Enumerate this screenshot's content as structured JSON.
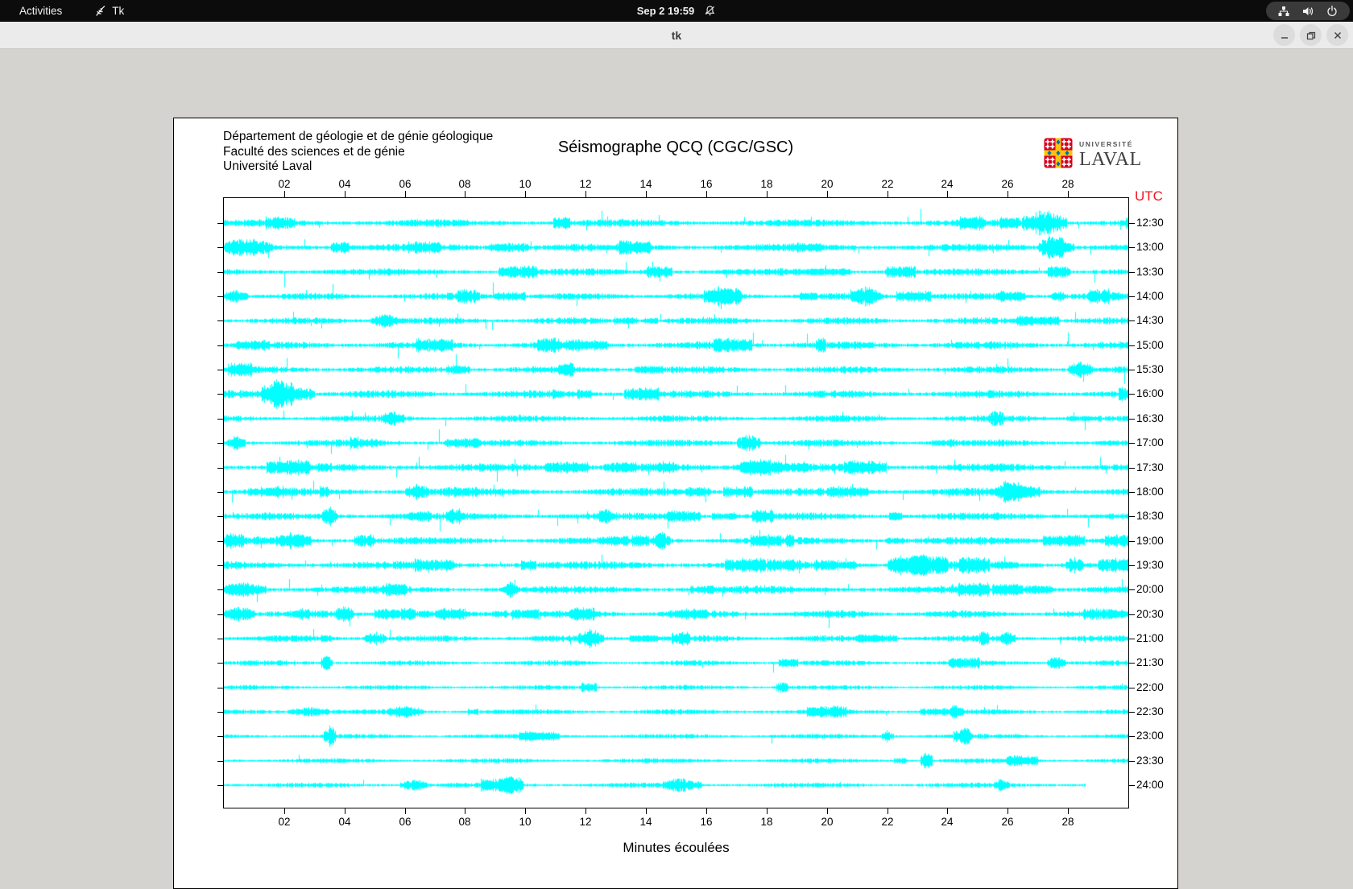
{
  "topbar": {
    "activities_label": "Activities",
    "app_name": "Tk",
    "clock": "Sep 2 19:59"
  },
  "titlebar": {
    "title": "tk"
  },
  "window": {
    "header_lines": [
      "Département de géologie et de génie géologique",
      "Faculté des sciences et de génie",
      "Université Laval"
    ],
    "logo": {
      "top_text": "UNIVERSITÉ",
      "bottom_text": "LAVAL",
      "red": "#d6001c",
      "yellow": "#ffc20e",
      "blue": "#0072bc"
    }
  },
  "chart_data": {
    "type": "line",
    "title": "Séismographe QCQ (CGC/GSC)",
    "xlabel": "Minutes écoulées",
    "right_axis_label": "UTC",
    "right_axis_label_color": "#f8141e",
    "trace_color": "#00ffff",
    "x_range_minutes": [
      0,
      30
    ],
    "x_ticks": [
      "02",
      "04",
      "06",
      "08",
      "10",
      "12",
      "14",
      "16",
      "18",
      "20",
      "22",
      "24",
      "26",
      "28"
    ],
    "x_tick_minutes": [
      2,
      4,
      6,
      8,
      10,
      12,
      14,
      16,
      18,
      20,
      22,
      24,
      26,
      28
    ],
    "traces": [
      {
        "label": "12:30",
        "seed": 101,
        "noise": 2.6,
        "spike_rate": 0.01,
        "spike_max": 24,
        "burst_rate": 0.006,
        "end": 1,
        "events": [
          {
            "x": 27.2,
            "amp": 14,
            "w": 1.5
          }
        ]
      },
      {
        "label": "13:00",
        "seed": 102,
        "noise": 2.6,
        "spike_rate": 0.01,
        "spike_max": 24,
        "burst_rate": 0.006,
        "end": 1,
        "events": [
          {
            "x": 0.8,
            "amp": 8,
            "w": 1.6
          },
          {
            "x": 27.6,
            "amp": 10,
            "w": 1.2
          }
        ]
      },
      {
        "label": "13:30",
        "seed": 103,
        "noise": 2.4,
        "spike_rate": 0.01,
        "spike_max": 22,
        "burst_rate": 0.005,
        "end": 1,
        "events": []
      },
      {
        "label": "14:00",
        "seed": 104,
        "noise": 2.4,
        "spike_rate": 0.01,
        "spike_max": 24,
        "burst_rate": 0.005,
        "end": 1,
        "events": [
          {
            "x": 0.4,
            "amp": 6,
            "w": 0.8
          },
          {
            "x": 16.5,
            "amp": 9,
            "w": 1.2
          },
          {
            "x": 21.3,
            "amp": 9,
            "w": 1.0
          }
        ]
      },
      {
        "label": "14:30",
        "seed": 105,
        "noise": 2.4,
        "spike_rate": 0.01,
        "spike_max": 22,
        "burst_rate": 0.005,
        "end": 1,
        "events": [
          {
            "x": 5.3,
            "amp": 7,
            "w": 0.9
          }
        ]
      },
      {
        "label": "15:00",
        "seed": 106,
        "noise": 2.6,
        "spike_rate": 0.009,
        "spike_max": 20,
        "burst_rate": 0.005,
        "end": 1,
        "events": []
      },
      {
        "label": "15:30",
        "seed": 107,
        "noise": 2.4,
        "spike_rate": 0.011,
        "spike_max": 24,
        "burst_rate": 0.005,
        "end": 1,
        "events": [
          {
            "x": 28.4,
            "amp": 10,
            "w": 0.8
          }
        ]
      },
      {
        "label": "16:00",
        "seed": 108,
        "noise": 2.6,
        "spike_rate": 0.01,
        "spike_max": 24,
        "burst_rate": 0.006,
        "end": 1,
        "events": [
          {
            "x": 1.8,
            "amp": 17,
            "w": 1.1
          },
          {
            "x": 2.6,
            "amp": 8,
            "w": 0.8
          }
        ]
      },
      {
        "label": "16:30",
        "seed": 109,
        "noise": 2.2,
        "spike_rate": 0.009,
        "spike_max": 20,
        "burst_rate": 0.005,
        "end": 1,
        "events": [
          {
            "x": 5.6,
            "amp": 6,
            "w": 0.8
          },
          {
            "x": 25.6,
            "amp": 8,
            "w": 0.5
          }
        ]
      },
      {
        "label": "17:00",
        "seed": 110,
        "noise": 2.4,
        "spike_rate": 0.01,
        "spike_max": 24,
        "burst_rate": 0.005,
        "end": 1,
        "events": [
          {
            "x": 0.4,
            "amp": 7,
            "w": 0.6
          },
          {
            "x": 17.4,
            "amp": 10,
            "w": 0.8
          }
        ]
      },
      {
        "label": "17:30",
        "seed": 111,
        "noise": 2.8,
        "spike_rate": 0.011,
        "spike_max": 22,
        "burst_rate": 0.007,
        "end": 1,
        "events": [
          {
            "x": 17.8,
            "amp": 7,
            "w": 1.4
          }
        ]
      },
      {
        "label": "18:00",
        "seed": 112,
        "noise": 2.8,
        "spike_rate": 0.01,
        "spike_max": 22,
        "burst_rate": 0.007,
        "end": 1,
        "events": [
          {
            "x": 6.4,
            "amp": 7,
            "w": 0.8
          },
          {
            "x": 26.0,
            "amp": 7,
            "w": 0.9
          }
        ]
      },
      {
        "label": "18:30",
        "seed": 113,
        "noise": 2.6,
        "spike_rate": 0.01,
        "spike_max": 24,
        "burst_rate": 0.006,
        "end": 1,
        "events": [
          {
            "x": 3.5,
            "amp": 12,
            "w": 0.5
          }
        ]
      },
      {
        "label": "19:00",
        "seed": 114,
        "noise": 2.6,
        "spike_rate": 0.01,
        "spike_max": 22,
        "burst_rate": 0.006,
        "end": 1,
        "events": [
          {
            "x": 2.3,
            "amp": 8,
            "w": 1.2
          },
          {
            "x": 14.5,
            "amp": 8,
            "w": 0.6
          }
        ]
      },
      {
        "label": "19:30",
        "seed": 115,
        "noise": 2.8,
        "spike_rate": 0.01,
        "spike_max": 20,
        "burst_rate": 0.008,
        "end": 1,
        "events": [
          {
            "x": 23.0,
            "amp": 7,
            "w": 2.0
          },
          {
            "x": 28.2,
            "amp": 9,
            "w": 0.6
          }
        ]
      },
      {
        "label": "20:00",
        "seed": 116,
        "noise": 2.6,
        "spike_rate": 0.01,
        "spike_max": 22,
        "burst_rate": 0.006,
        "end": 1,
        "events": [
          {
            "x": 0.7,
            "amp": 7,
            "w": 1.4
          },
          {
            "x": 9.5,
            "amp": 8,
            "w": 0.5
          }
        ]
      },
      {
        "label": "20:30",
        "seed": 117,
        "noise": 2.6,
        "spike_rate": 0.01,
        "spike_max": 20,
        "burst_rate": 0.006,
        "end": 1,
        "events": [
          {
            "x": 0.5,
            "amp": 8,
            "w": 1.0
          },
          {
            "x": 4.0,
            "amp": 8,
            "w": 0.6
          }
        ]
      },
      {
        "label": "21:00",
        "seed": 118,
        "noise": 2.2,
        "spike_rate": 0.008,
        "spike_max": 18,
        "burst_rate": 0.005,
        "end": 1,
        "events": [
          {
            "x": 5.0,
            "amp": 7,
            "w": 0.7
          },
          {
            "x": 12.3,
            "amp": 7,
            "w": 0.6
          },
          {
            "x": 26.0,
            "amp": 7,
            "w": 0.5
          }
        ]
      },
      {
        "label": "21:30",
        "seed": 119,
        "noise": 1.8,
        "spike_rate": 0.004,
        "spike_max": 15,
        "burst_rate": 0.003,
        "end": 1,
        "events": [
          {
            "x": 3.4,
            "amp": 9,
            "w": 0.4
          },
          {
            "x": 27.6,
            "amp": 8,
            "w": 0.6
          }
        ]
      },
      {
        "label": "22:00",
        "seed": 120,
        "noise": 1.6,
        "spike_rate": 0.003,
        "spike_max": 13,
        "burst_rate": 0.002,
        "end": 1,
        "events": [
          {
            "x": 18.5,
            "amp": 8,
            "w": 0.4
          }
        ]
      },
      {
        "label": "22:30",
        "seed": 121,
        "noise": 1.8,
        "spike_rate": 0.004,
        "spike_max": 14,
        "burst_rate": 0.003,
        "end": 1,
        "events": [
          {
            "x": 2.8,
            "amp": 5,
            "w": 1.4
          },
          {
            "x": 6.0,
            "amp": 5,
            "w": 1.2
          },
          {
            "x": 24.3,
            "amp": 6,
            "w": 0.4
          }
        ]
      },
      {
        "label": "23:00",
        "seed": 122,
        "noise": 1.6,
        "spike_rate": 0.003,
        "spike_max": 13,
        "burst_rate": 0.002,
        "end": 1,
        "events": [
          {
            "x": 3.5,
            "amp": 12,
            "w": 0.4
          },
          {
            "x": 22.0,
            "amp": 6,
            "w": 0.4
          },
          {
            "x": 24.6,
            "amp": 6,
            "w": 0.4
          }
        ]
      },
      {
        "label": "23:30",
        "seed": 123,
        "noise": 1.6,
        "spike_rate": 0.003,
        "spike_max": 12,
        "burst_rate": 0.002,
        "end": 1,
        "events": [
          {
            "x": 23.3,
            "amp": 12,
            "w": 0.4
          }
        ]
      },
      {
        "label": "24:00",
        "seed": 124,
        "noise": 1.7,
        "spike_rate": 0.004,
        "spike_max": 12,
        "burst_rate": 0.003,
        "end": 0.953,
        "events": [
          {
            "x": 6.3,
            "amp": 6,
            "w": 0.9
          },
          {
            "x": 9.5,
            "amp": 5,
            "w": 0.7
          },
          {
            "x": 15.2,
            "amp": 7,
            "w": 1.3
          },
          {
            "x": 25.8,
            "amp": 6,
            "w": 0.5
          }
        ]
      }
    ]
  }
}
